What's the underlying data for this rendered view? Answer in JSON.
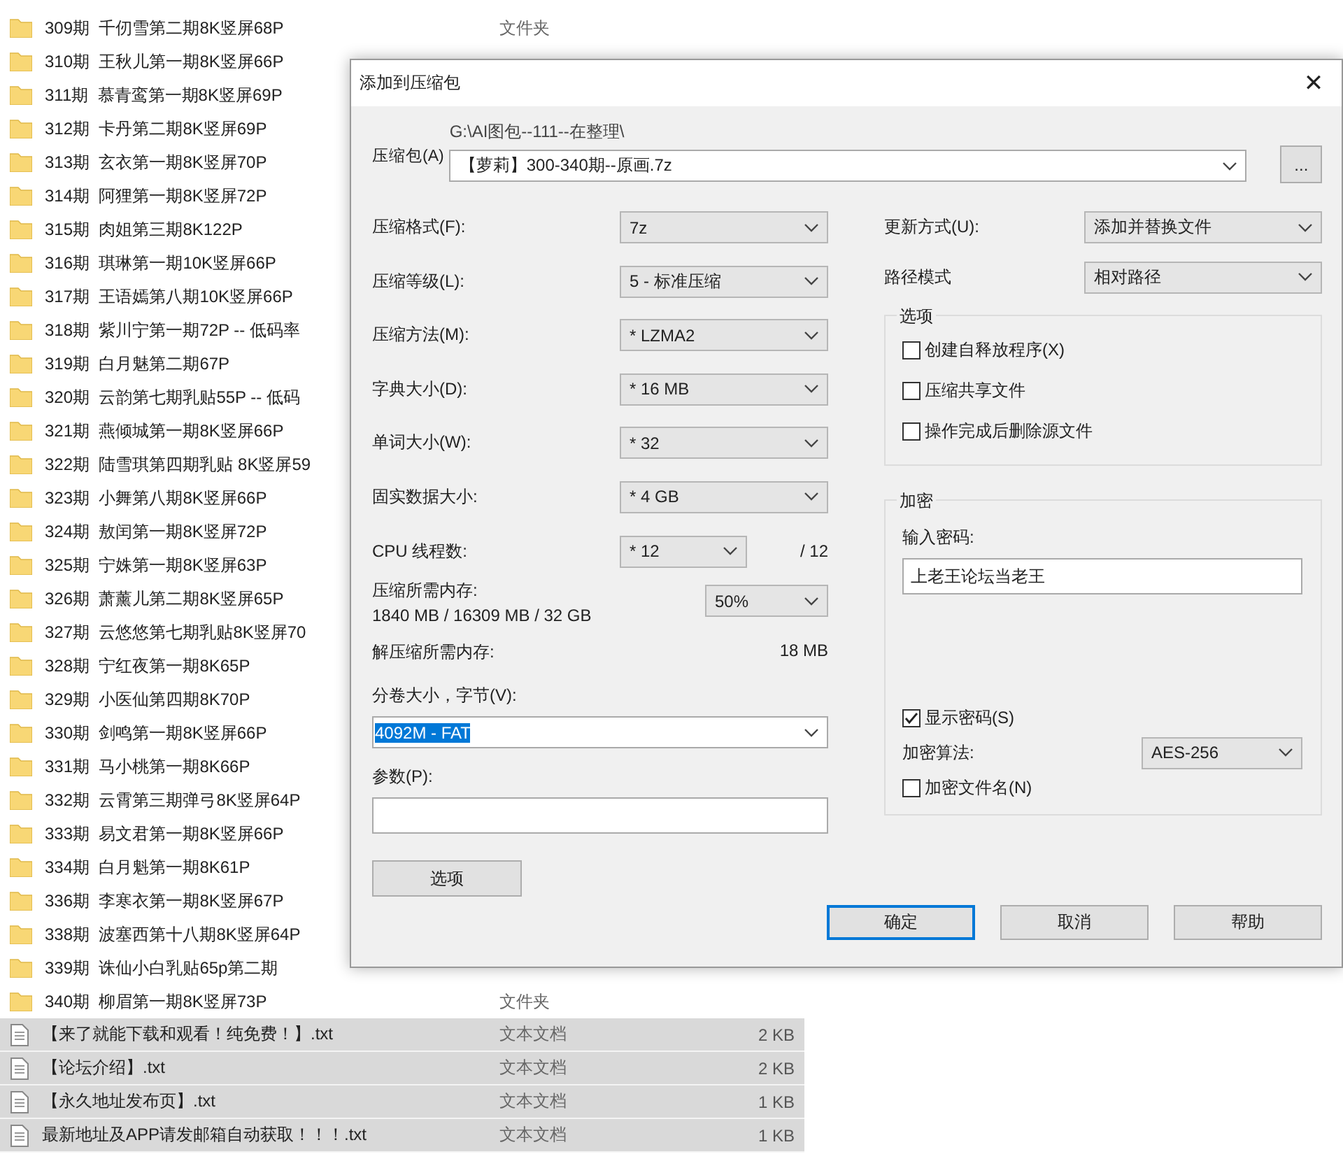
{
  "explorer": {
    "rows": [
      {
        "kind": "folder",
        "name": "309期  千仞雪第二期8K竖屏68P",
        "type": "文件夹",
        "selected": false
      },
      {
        "kind": "folder",
        "name": "310期  王秋儿第一期8K竖屏66P",
        "selected": false
      },
      {
        "kind": "folder",
        "name": "311期  慕青鸾第一期8K竖屏69P",
        "selected": false
      },
      {
        "kind": "folder",
        "name": "312期  卡丹第二期8K竖屏69P",
        "selected": false
      },
      {
        "kind": "folder",
        "name": "313期  玄衣第一期8K竖屏70P",
        "selected": false
      },
      {
        "kind": "folder",
        "name": "314期  阿狸第一期8K竖屏72P",
        "selected": false
      },
      {
        "kind": "folder",
        "name": "315期  肉姐第三期8K122P",
        "selected": false
      },
      {
        "kind": "folder",
        "name": "316期  琪琳第一期10K竖屏66P",
        "selected": false
      },
      {
        "kind": "folder",
        "name": "317期  王语嫣第八期10K竖屏66P",
        "selected": false
      },
      {
        "kind": "folder",
        "name": "318期  紫川宁第一期72P -- 低码率",
        "selected": false
      },
      {
        "kind": "folder",
        "name": "319期  白月魅第二期67P",
        "selected": false
      },
      {
        "kind": "folder",
        "name": "320期  云韵第七期乳贴55P -- 低码",
        "selected": false
      },
      {
        "kind": "folder",
        "name": "321期  燕倾城第一期8K竖屏66P",
        "selected": false
      },
      {
        "kind": "folder",
        "name": "322期  陆雪琪第四期乳贴 8K竖屏59",
        "selected": false
      },
      {
        "kind": "folder",
        "name": "323期  小舞第八期8K竖屏66P",
        "selected": false
      },
      {
        "kind": "folder",
        "name": "324期  敖闰第一期8K竖屏72P",
        "selected": false
      },
      {
        "kind": "folder",
        "name": "325期  宁姝第一期8K竖屏63P",
        "selected": false
      },
      {
        "kind": "folder",
        "name": "326期  萧薰儿第二期8K竖屏65P",
        "selected": false
      },
      {
        "kind": "folder",
        "name": "327期  云悠悠第七期乳贴8K竖屏70",
        "selected": false
      },
      {
        "kind": "folder",
        "name": "328期  宁红夜第一期8K65P",
        "selected": false
      },
      {
        "kind": "folder",
        "name": "329期  小医仙第四期8K70P",
        "selected": false
      },
      {
        "kind": "folder",
        "name": "330期  剑鸣第一期8K竖屏66P",
        "selected": false
      },
      {
        "kind": "folder",
        "name": "331期  马小桃第一期8K66P",
        "selected": false
      },
      {
        "kind": "folder",
        "name": "332期  云霄第三期弹弓8K竖屏64P",
        "selected": false
      },
      {
        "kind": "folder",
        "name": "333期  易文君第一期8K竖屏66P",
        "selected": false
      },
      {
        "kind": "folder",
        "name": "334期  白月魁第一期8K61P",
        "selected": false
      },
      {
        "kind": "folder",
        "name": "336期  李寒衣第一期8K竖屏67P",
        "selected": false
      },
      {
        "kind": "folder",
        "name": "338期  波塞西第十八期8K竖屏64P",
        "selected": false
      },
      {
        "kind": "folder",
        "name": "339期  诛仙小白乳贴65p第二期",
        "selected": false
      },
      {
        "kind": "folder",
        "name": "340期  柳眉第一期8K竖屏73P",
        "type": "文件夹",
        "selected": false
      },
      {
        "kind": "text",
        "name": "【来了就能下载和观看！纯免费！】.txt",
        "type": "文本文档",
        "size": "2 KB",
        "selected": true
      },
      {
        "kind": "text",
        "name": "【论坛介绍】.txt",
        "type": "文本文档",
        "size": "2 KB",
        "selected": true
      },
      {
        "kind": "text",
        "name": "【永久地址发布页】.txt",
        "type": "文本文档",
        "size": "1 KB",
        "selected": true
      },
      {
        "kind": "text",
        "name": "最新地址及APP请发邮箱自动获取！！！.txt",
        "type": "文本文档",
        "size": "1 KB",
        "selected": true
      }
    ]
  },
  "dialog": {
    "title": "添加到压缩包",
    "close": "✕",
    "archive_label": "压缩包(A)",
    "archive_path": "G:\\AI图包--111--在整理\\",
    "archive_name": "【萝莉】300-340期--原画.7z",
    "browse": "...",
    "settings": [
      {
        "label": "压缩格式(F):",
        "value": "7z"
      },
      {
        "label": "压缩等级(L):",
        "value": "5 - 标准压缩"
      },
      {
        "label": "压缩方法(M):",
        "value": "* LZMA2"
      },
      {
        "label": "字典大小(D):",
        "value": "* 16 MB"
      },
      {
        "label": "单词大小(W):",
        "value": "* 32"
      },
      {
        "label": "固实数据大小:",
        "value": "* 4 GB"
      }
    ],
    "threads": {
      "label": "CPU 线程数:",
      "value": "* 12",
      "max": "/ 12"
    },
    "memory": {
      "label": "压缩所需内存:",
      "detail": "1840 MB / 16309 MB / 32 GB",
      "value": "50%"
    },
    "decompress_memory": {
      "label": "解压缩所需内存:",
      "value": "18 MB"
    },
    "volume": {
      "label": "分卷大小，字节(V):",
      "value": "4092M - FAT",
      "highlighted": true
    },
    "parameters": {
      "label": "参数(P):"
    },
    "options_button": "选项",
    "update_mode": {
      "label": "更新方式(U):",
      "value": "添加并替换文件"
    },
    "path_mode": {
      "label": "路径模式",
      "value": "相对路径"
    },
    "options_group": {
      "title": "选项",
      "checkboxes": [
        {
          "label": "创建自释放程序(X)",
          "checked": false
        },
        {
          "label": "压缩共享文件",
          "checked": false
        },
        {
          "label": "操作完成后删除源文件",
          "checked": false
        }
      ]
    },
    "encryption": {
      "title": "加密",
      "password_label": "输入密码:",
      "password": "上老王论坛当老王",
      "show_password": {
        "label": "显示密码(S)",
        "checked": true
      },
      "method_label": "加密算法:",
      "method": "AES-256",
      "encrypt_names": {
        "label": "加密文件名(N)",
        "checked": false
      }
    },
    "buttons": [
      {
        "label": "确定",
        "focused": true
      },
      {
        "label": "取消",
        "focused": false
      },
      {
        "label": "帮助",
        "focused": false
      }
    ]
  }
}
